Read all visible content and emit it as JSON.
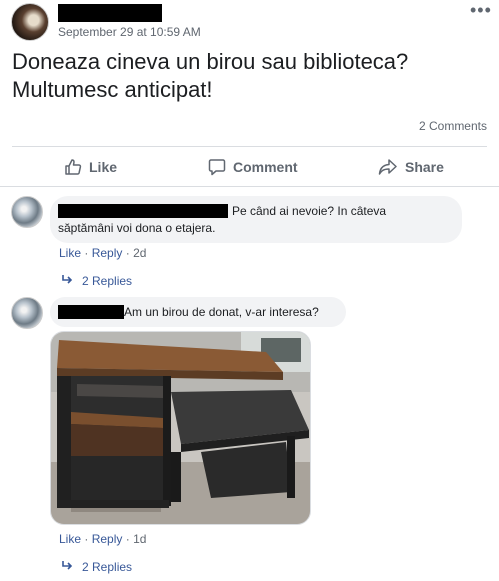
{
  "post": {
    "timestamp": "September 29 at 10:59 AM",
    "more_icon": "•••",
    "text_line1": "Doneaza cineva un birou sau biblioteca?",
    "text_line2": "Multumesc anticipat!",
    "comments_count": "2 Comments"
  },
  "actions": {
    "like": "Like",
    "comment": "Comment",
    "share": "Share"
  },
  "comments": [
    {
      "text_part1": "Pe când ai nevoie? In câteva",
      "text_part2": "săptămâni voi dona o etajera.",
      "like": "Like",
      "reply": "Reply",
      "separator": "·",
      "time": "2d",
      "replies": "2 Replies"
    },
    {
      "text": "Am un birou de donat, v-ar interesa?",
      "like": "Like",
      "reply": "Reply",
      "separator": "·",
      "time": "1d",
      "replies": "2 Replies"
    }
  ],
  "colors": {
    "link": "#385898",
    "muted": "#606770",
    "bubble": "#f2f3f5",
    "divider": "#dadde1"
  }
}
